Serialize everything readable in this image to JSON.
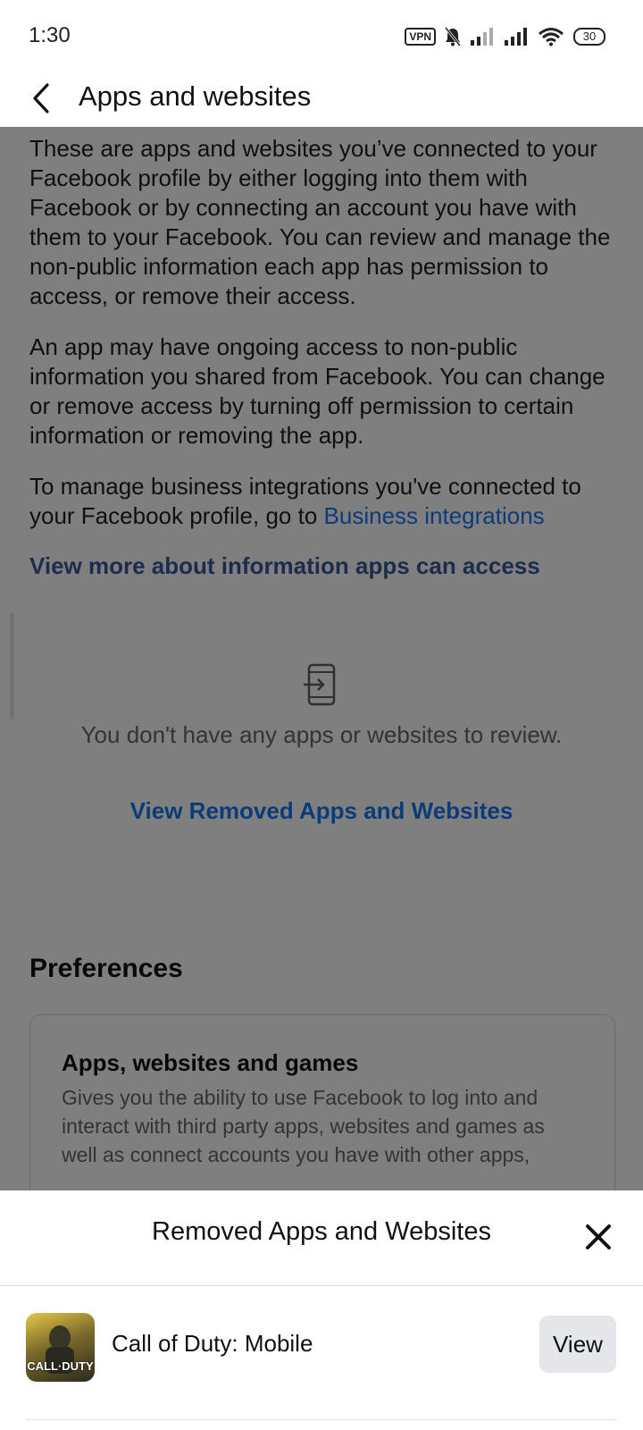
{
  "status_bar": {
    "time": "1:30",
    "vpn": "VPN",
    "battery": "30",
    "icons": [
      "vpn-icon",
      "mute-bell-icon",
      "signal-icon",
      "signal-icon",
      "wifi-icon",
      "battery-icon"
    ]
  },
  "header": {
    "title": "Apps and websites",
    "back_icon": "back-arrow-icon"
  },
  "main": {
    "para1": "These are apps and websites you’ve connected to your Facebook profile by either logging into them with Facebook or by connecting an account you have with them to your Facebook. You can review and manage the non-public information each app has permission to access, or remove their access.",
    "para2": "An app may have ongoing access to non-public information you shared from Facebook. You can change or remove access by turning off permission to certain information or removing the app.",
    "para3_prefix": "To manage business integrations you've connected to your Facebook profile, go to ",
    "para3_link": "Business integrations",
    "view_more_link": "View more about information apps can access",
    "empty_text": "You don't have any apps or websites to review.",
    "view_removed_link": "View Removed Apps and Websites",
    "preferences_heading": "Preferences",
    "pref_card": {
      "title": "Apps, websites and games",
      "description": "Gives you the ability to use Facebook to log into and interact with third party apps, websites and games as well as connect accounts you have with other apps,"
    }
  },
  "sheet": {
    "title": "Removed Apps and Websites",
    "apps": [
      {
        "name": "Call of Duty: Mobile",
        "icon_text": "CALL·DUTY",
        "button": "View"
      }
    ]
  },
  "colors": {
    "link_blue": "#1877f2",
    "overlay": "rgba(0,0,0,0.5)",
    "button_gray": "#e4e6eb"
  }
}
